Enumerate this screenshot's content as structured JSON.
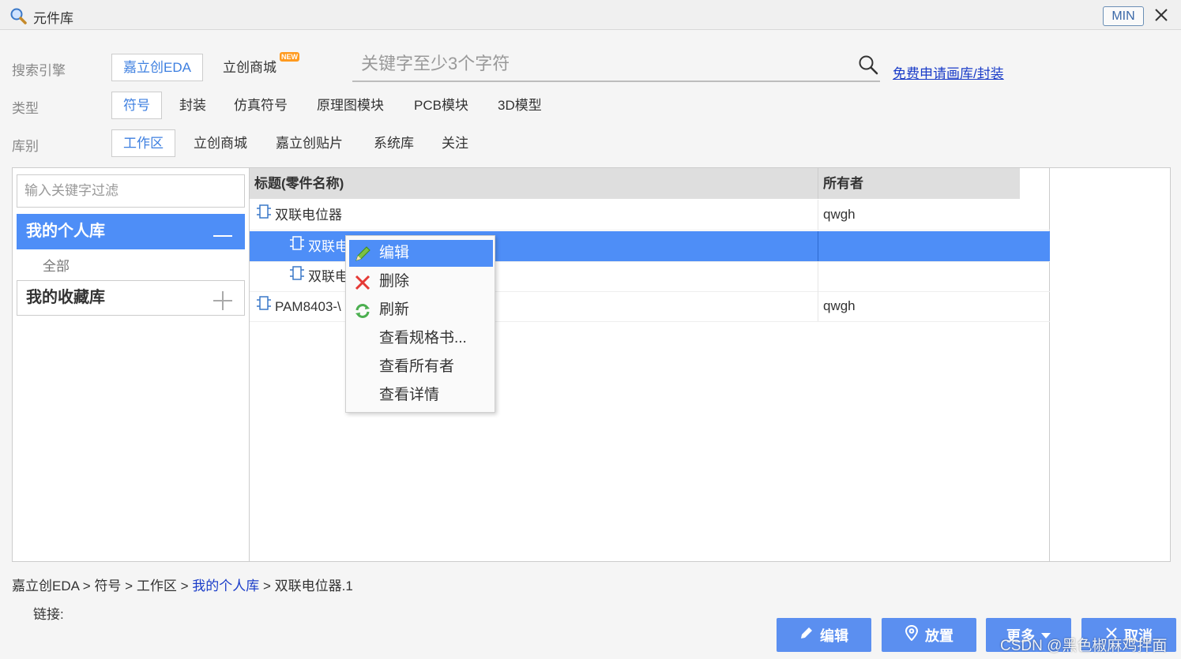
{
  "window": {
    "title": "元件库",
    "min_label": "MIN"
  },
  "filters": {
    "engine": {
      "label": "搜索引擎",
      "options": [
        "嘉立创EDA",
        "立创商城"
      ],
      "new_badge": "NEW"
    },
    "type": {
      "label": "类型",
      "options": [
        "符号",
        "封装",
        "仿真符号",
        "原理图模块",
        "PCB模块",
        "3D模型"
      ]
    },
    "library": {
      "label": "库别",
      "options": [
        "工作区",
        "立创商城",
        "嘉立创贴片",
        "系统库",
        "关注"
      ]
    }
  },
  "search": {
    "placeholder": "关键字至少3个字符",
    "free_link": "免费申请画库/封装"
  },
  "left": {
    "filter_placeholder": "输入关键字过滤",
    "personal_lib": "我的个人库",
    "all": "全部",
    "fav_lib": "我的收藏库"
  },
  "table": {
    "col_title": "标题(零件名称)",
    "col_owner": "所有者",
    "rows": [
      {
        "title": "双联电位器",
        "owner": "qwgh"
      },
      {
        "title": "双联电",
        "owner": ""
      },
      {
        "title": "双联电",
        "owner": ""
      },
      {
        "title": "PAM8403-\\",
        "owner": "qwgh"
      }
    ]
  },
  "context_menu": [
    "编辑",
    "删除",
    "刷新",
    "查看规格书...",
    "查看所有者",
    "查看详情"
  ],
  "breadcrumb": {
    "p1": "嘉立创EDA",
    "p2": "符号",
    "p3": "工作区",
    "p4": "我的个人库",
    "p5": "双联电位器.1",
    "sep": ">"
  },
  "link_label": "链接:",
  "footer": {
    "edit": "编辑",
    "place": "放置",
    "more": "更多",
    "cancel": "取消"
  },
  "watermark": "CSDN @黑色椒麻鸡拌面",
  "colors": {
    "accent": "#4e8ef7",
    "button": "#5b8ff0",
    "link": "#1a3cc8"
  }
}
